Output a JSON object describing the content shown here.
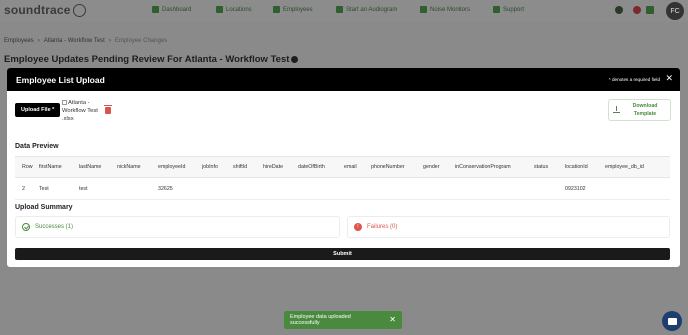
{
  "app": {
    "logo_text": "soundtrace"
  },
  "nav": {
    "items": [
      {
        "label": "Dashboard",
        "icon": "dashboard-icon"
      },
      {
        "label": "Locations",
        "icon": "location-pin-icon"
      },
      {
        "label": "Employees",
        "icon": "people-icon"
      },
      {
        "label": "Start an Audiogram",
        "icon": "headphones-icon"
      },
      {
        "label": "Noise Monitors",
        "icon": "sensor-icon"
      },
      {
        "label": "Support",
        "icon": "support-icon"
      }
    ],
    "avatar_initials": "FC"
  },
  "breadcrumb": [
    "Employees",
    "Atlanta - Workflow Test",
    "Employee Changes"
  ],
  "page_title": "Employee Updates Pending Review For Atlanta - Workflow Test",
  "modal": {
    "title": "Employee List Upload",
    "required_note": "* denotes a required field",
    "upload_button": "Upload File *",
    "file_alt": "Atlanta - Workflow Test .xlsx",
    "download_template": "Download Template",
    "data_preview_heading": "Data Preview",
    "table": {
      "columns": [
        "Row",
        "firstName",
        "lastName",
        "nickName",
        "employeeId",
        "jobInfo",
        "shiftId",
        "hireDate",
        "dateOfBirth",
        "email",
        "phoneNumber",
        "gender",
        "inConservationProgram",
        "status",
        "locationId",
        "employee_db_id"
      ],
      "rows": [
        [
          "2",
          "Test",
          "test",
          "",
          "32625",
          "",
          "",
          "",
          "",
          "",
          "",
          "",
          "",
          "",
          "0923102",
          ""
        ]
      ]
    },
    "upload_summary_heading": "Upload Summary",
    "successes_label": "Successes (1)",
    "failures_label": "Failures (0)",
    "submit_label": "Submit"
  },
  "toast": {
    "message": "Employee data uploaded successfully"
  },
  "colors": {
    "accent_green": "#4a8a3f",
    "error_red": "#e0554a",
    "header_black": "#000000"
  }
}
